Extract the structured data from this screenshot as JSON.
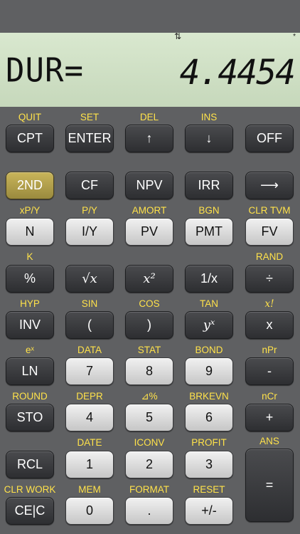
{
  "display": {
    "label": "DUR=",
    "value": "4.4454",
    "arrows_indicator": "⇅",
    "star_indicator": "*"
  },
  "keys": {
    "r1": [
      {
        "second": "QUIT",
        "label": "CPT"
      },
      {
        "second": "SET",
        "label": "ENTER"
      },
      {
        "second": "DEL",
        "label": "↑"
      },
      {
        "second": "INS",
        "label": "↓"
      },
      {
        "second": "",
        "label": "OFF"
      }
    ],
    "r2": [
      {
        "second": "",
        "label": "2ND"
      },
      {
        "second": "",
        "label": "CF"
      },
      {
        "second": "",
        "label": "NPV"
      },
      {
        "second": "",
        "label": "IRR"
      },
      {
        "second": "",
        "label": "⟶"
      }
    ],
    "r3": [
      {
        "second": "xP/Y",
        "label": "N"
      },
      {
        "second": "P/Y",
        "label": "I/Y"
      },
      {
        "second": "AMORT",
        "label": "PV"
      },
      {
        "second": "BGN",
        "label": "PMT"
      },
      {
        "second": "CLR TVM",
        "label": "FV"
      }
    ],
    "r4": [
      {
        "second": "K",
        "label": "%"
      },
      {
        "second": "",
        "label": "√x"
      },
      {
        "second": "",
        "label": "x²"
      },
      {
        "second": "",
        "label": "1/x"
      },
      {
        "second": "RAND",
        "label": "÷"
      }
    ],
    "r5": [
      {
        "second": "HYP",
        "label": "INV"
      },
      {
        "second": "SIN",
        "label": "("
      },
      {
        "second": "COS",
        "label": ")"
      },
      {
        "second": "TAN",
        "label": "yˣ"
      },
      {
        "second": "x!",
        "label": "x"
      }
    ],
    "r6": [
      {
        "second": "eˣ",
        "label": "LN"
      },
      {
        "second": "DATA",
        "label": "7"
      },
      {
        "second": "STAT",
        "label": "8"
      },
      {
        "second": "BOND",
        "label": "9"
      },
      {
        "second": "nPr",
        "label": "-"
      }
    ],
    "r7": [
      {
        "second": "ROUND",
        "label": "STO"
      },
      {
        "second": "DEPR",
        "label": "4"
      },
      {
        "second": "⊿%",
        "label": "5"
      },
      {
        "second": "BRKEVN",
        "label": "6"
      },
      {
        "second": "nCr",
        "label": "+"
      }
    ],
    "r8": [
      {
        "second": "",
        "label": "RCL"
      },
      {
        "second": "DATE",
        "label": "1"
      },
      {
        "second": "ICONV",
        "label": "2"
      },
      {
        "second": "PROFIT",
        "label": "3"
      },
      {
        "second": "ANS",
        "label": "="
      }
    ],
    "r9": [
      {
        "second": "CLR WORK",
        "label": "CE|C"
      },
      {
        "second": "MEM",
        "label": "0"
      },
      {
        "second": "FORMAT",
        "label": "."
      },
      {
        "second": "RESET",
        "label": "+/-"
      }
    ]
  }
}
